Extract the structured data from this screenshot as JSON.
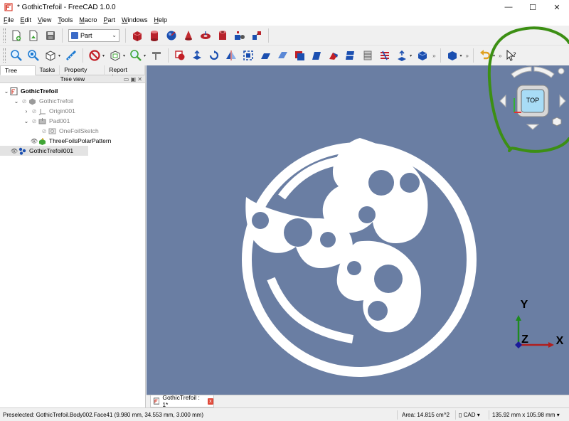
{
  "window": {
    "title": "* GothicTrefoil - FreeCAD 1.0.0",
    "minimize": "—",
    "maximize": "☐",
    "close": "✕"
  },
  "menu": [
    "File",
    "Edit",
    "View",
    "Tools",
    "Macro",
    "Part",
    "Windows",
    "Help"
  ],
  "workbench": {
    "selected": "Part"
  },
  "combo": {
    "tabs": [
      "Tree view",
      "Tasks",
      "Property view",
      "Report view"
    ],
    "header": "Tree view",
    "tree": [
      {
        "label": "GothicTrefoil",
        "depth": 0,
        "twisty": "v",
        "eye": "",
        "kind": "doc",
        "dim": false,
        "bold": true
      },
      {
        "label": "GothicTrefoil",
        "depth": 1,
        "twisty": "v",
        "eye": "hidden",
        "kind": "body",
        "dim": true
      },
      {
        "label": "Origin001",
        "depth": 2,
        "twisty": ">",
        "eye": "hidden",
        "kind": "origin",
        "dim": true
      },
      {
        "label": "Pad001",
        "depth": 2,
        "twisty": "v",
        "eye": "hidden",
        "kind": "pad",
        "dim": true
      },
      {
        "label": "OneFoilSketch",
        "depth": 3,
        "twisty": "",
        "eye": "hidden",
        "kind": "sketch",
        "dim": true
      },
      {
        "label": "ThreeFoilsPolarPattern",
        "depth": 2,
        "twisty": "",
        "eye": "visible",
        "kind": "pattern",
        "dim": false
      },
      {
        "label": "GothicTrefoil001",
        "depth": 0,
        "twisty": "",
        "eye": "visible",
        "kind": "body2",
        "dim": false,
        "selected": true
      }
    ]
  },
  "view": {
    "background": "#6a7ea3",
    "navcube_face": "TOP",
    "axes": {
      "x": "X",
      "y": "Y",
      "z": "Z"
    },
    "annotation_color": "#3c8f14"
  },
  "doc_tab": {
    "label": "GothicTrefoil : 1*",
    "close": "x"
  },
  "status": {
    "message": "Preselected: GothicTrefoil.Body002.Face41 (9.980 mm, 34.553 mm, 3.000 mm)",
    "area": "Area: 14.815 cm^2",
    "nav_style": "CAD",
    "dimensions": "135.92 mm x 105.98 mm"
  }
}
